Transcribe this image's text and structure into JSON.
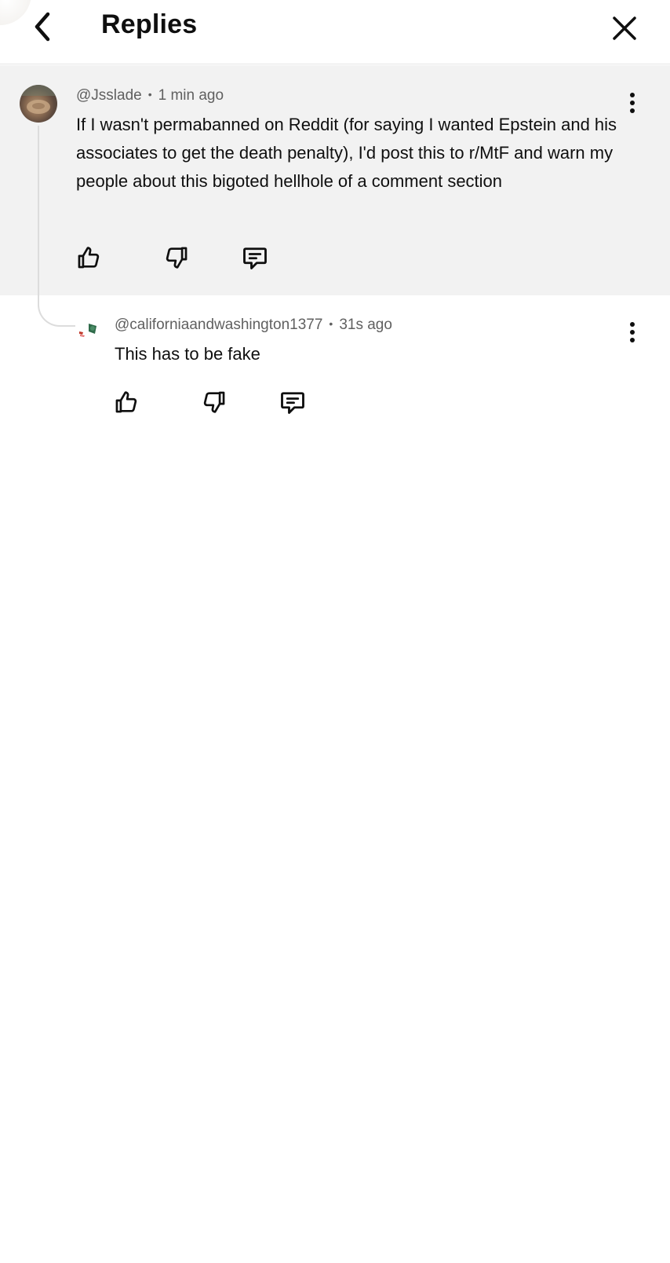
{
  "header": {
    "title": "Replies"
  },
  "parent_comment": {
    "author": "@Jsslade",
    "time": "1 min ago",
    "text": "If I wasn't permabanned on Reddit (for saying I wanted Epstein and his associates to get the death penalty), I'd post this to r/MtF and warn my people about this bigoted hellhole of a comment section"
  },
  "reply": {
    "author": "@californiaandwashington1377",
    "time": "31s ago",
    "text": "This has to be fake"
  },
  "icons": {
    "back": "chevron-left-icon",
    "close": "close-icon",
    "more": "more-vertical-icon",
    "like": "thumbs-up-icon",
    "dislike": "thumbs-down-icon",
    "reply": "comment-icon"
  },
  "colors": {
    "parent_background": "#f2f2f2",
    "meta_text": "#606060",
    "text": "#0f0f0f"
  }
}
